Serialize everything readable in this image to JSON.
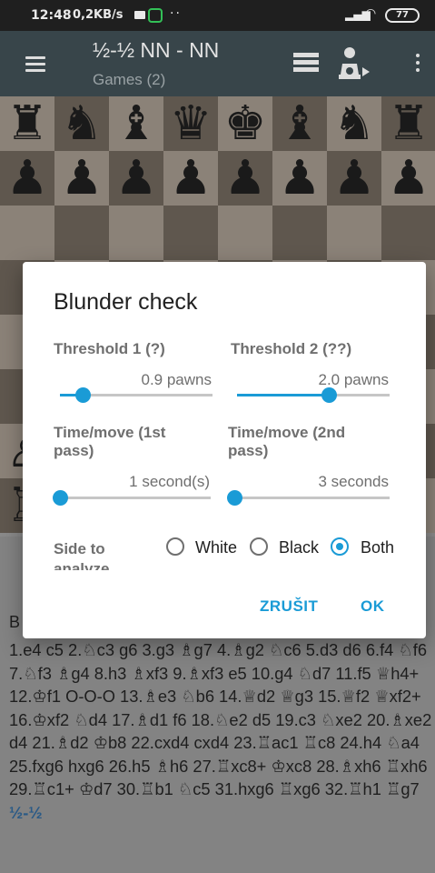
{
  "status": {
    "time": "12:48",
    "speed": "0,2KB/s",
    "dots": "··",
    "battery": "77"
  },
  "toolbar": {
    "title": "½-½ NN - NN",
    "subtitle": "Games (2)"
  },
  "board": {
    "rank8": [
      "♜",
      "♞",
      "♝",
      "♛",
      "♚",
      "♝",
      "♞",
      "♜"
    ],
    "rank7": [
      "♟",
      "♟",
      "♟",
      "♟",
      "♟",
      "♟",
      "♟",
      "♟"
    ],
    "rank2": [
      "♙",
      "♙",
      "♙",
      "♙",
      "♙",
      "♙",
      "♙",
      "♙"
    ],
    "rank1": [
      "♖",
      "♘",
      "♗",
      "♕",
      "♔",
      "♗",
      "♘",
      "♖"
    ]
  },
  "dialog": {
    "title": "Blunder check",
    "threshold1": {
      "label": "Threshold 1 (?)",
      "value": "0.9 pawns",
      "fraction": 0.15
    },
    "threshold2": {
      "label": "Threshold 2 (??)",
      "value": "2.0 pawns",
      "fraction": 0.6
    },
    "time1": {
      "label": "Time/move (1st pass)",
      "value": "1 second(s)",
      "fraction": 0.0
    },
    "time2": {
      "label": "Time/move (2nd pass)",
      "value": "3 seconds",
      "fraction": 0.0
    },
    "side": {
      "label": "Side to analyze",
      "options": [
        "White",
        "Black",
        "Both"
      ],
      "selected": "Both"
    },
    "cancel": "ZRUŠIT",
    "ok": "OK"
  },
  "moves": {
    "partial": "B",
    "text": "1.e4 c5 2.♘c3 g6 3.g3 ♗g7 4.♗g2 ♘c6 5.d3 d6 6.f4 ♘f6 7.♘f3 ♗g4 8.h3 ♗xf3 9.♗xf3 e5 10.g4 ♘d7 11.f5 ♕h4+ 12.♔f1 O-O-O 13.♗e3 ♘b6 14.♕d2 ♕g3 15.♕f2 ♕xf2+ 16.♔xf2 ♘d4 17.♗d1 f6 18.♘e2 d5 19.c3 ♘xe2 20.♗xe2 d4 21.♗d2 ♔b8 22.cxd4 cxd4 23.♖ac1 ♖c8 24.h4 ♘a4 25.fxg6 hxg6 26.h5 ♗h6 27.♖xc8+ ♔xc8 28.♗xh6 ♖xh6 29.♖c1+ ♔d7 30.♖b1 ♘c5 31.hxg6 ♖xg6 32.♖h1 ♖g7",
    "result": "½-½"
  },
  "colors": {
    "accent": "#1a9bd6",
    "toolbar": "#38454a"
  }
}
